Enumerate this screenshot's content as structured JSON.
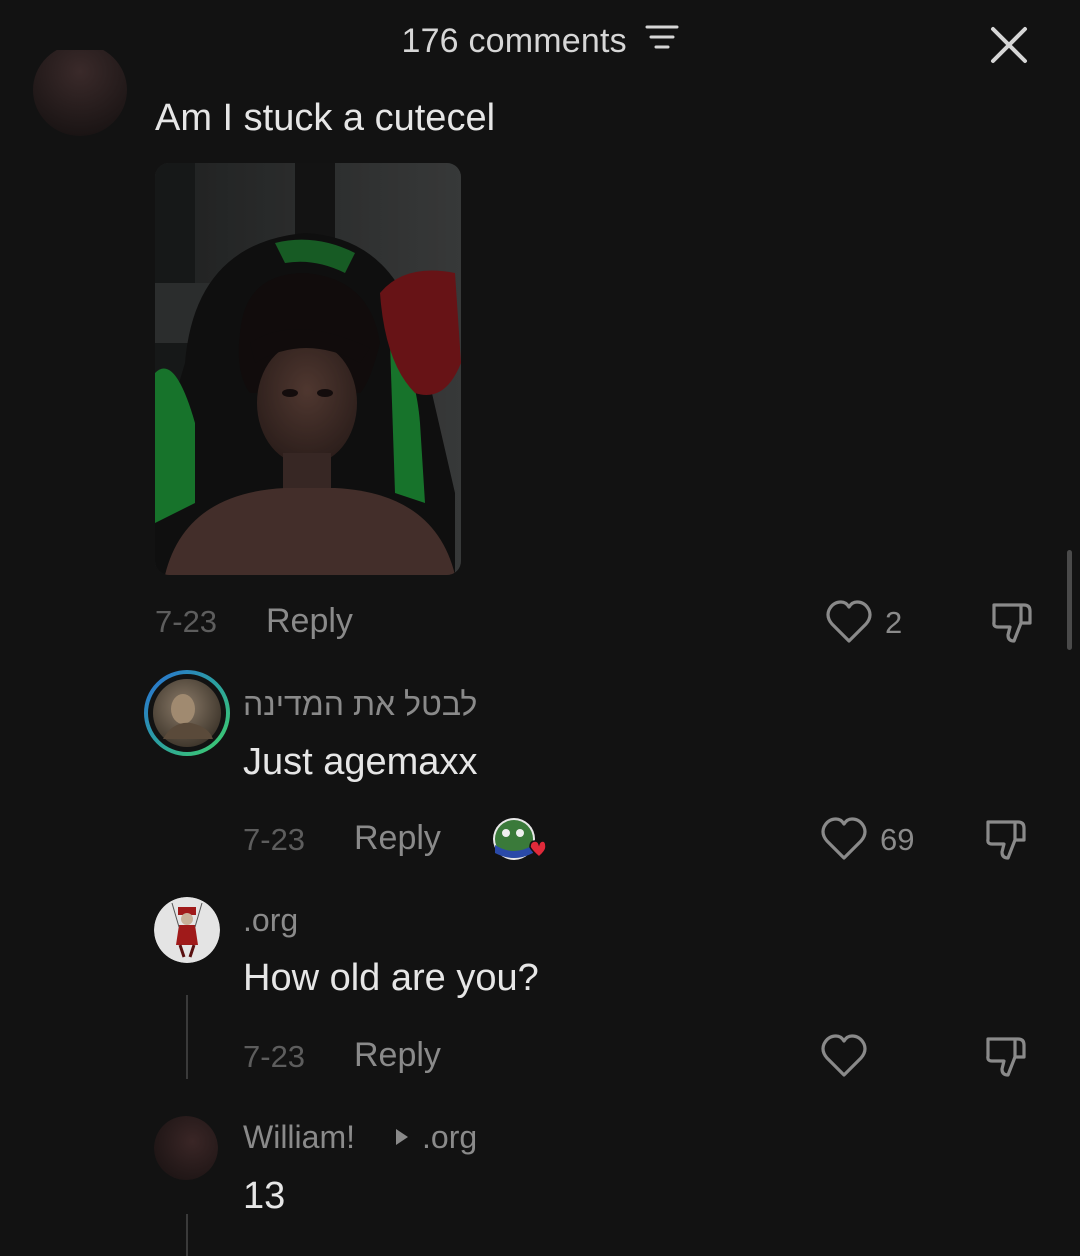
{
  "header": {
    "title": "176 comments"
  },
  "comments": [
    {
      "text": "Am I stuck a cutecel",
      "date": "7-23",
      "reply_label": "Reply",
      "likes": "2"
    },
    {
      "username": "לבטל את המדינה",
      "text": "Just agemaxx",
      "date": "7-23",
      "reply_label": "Reply",
      "likes": "69"
    },
    {
      "username": ".org",
      "text": "How old are you?",
      "date": "7-23",
      "reply_label": "Reply",
      "likes": ""
    },
    {
      "username": "William!",
      "reply_to": ".org",
      "text": "13"
    }
  ],
  "colors": {
    "background": "#121212",
    "primary_text": "#e6e6e6",
    "secondary_text": "#8a8a8a",
    "muted_text": "#5d5d5d",
    "heart_badge": "#e02a3a"
  }
}
